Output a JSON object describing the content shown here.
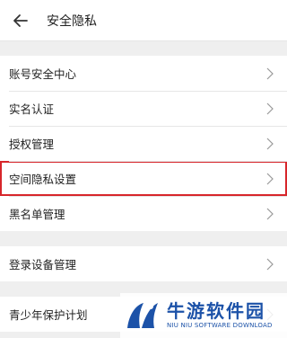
{
  "header": {
    "title": "安全隐私",
    "back_icon": "arrow-left-icon"
  },
  "group1": [
    {
      "label": "账号安全中心"
    },
    {
      "label": "实名认证"
    },
    {
      "label": "授权管理"
    },
    {
      "label": "空间隐私设置",
      "highlighted": true
    },
    {
      "label": "黑名单管理"
    }
  ],
  "group2": [
    {
      "label": "登录设备管理"
    }
  ],
  "group3": [
    {
      "label": "青少年保护计划"
    }
  ],
  "watermark": {
    "title": "牛游软件园",
    "subtitle": "NIU NIU SOFTWARE DOWNLOAD"
  },
  "colors": {
    "highlight_border": "#d7262b",
    "watermark_blue": "#1c52a8"
  }
}
